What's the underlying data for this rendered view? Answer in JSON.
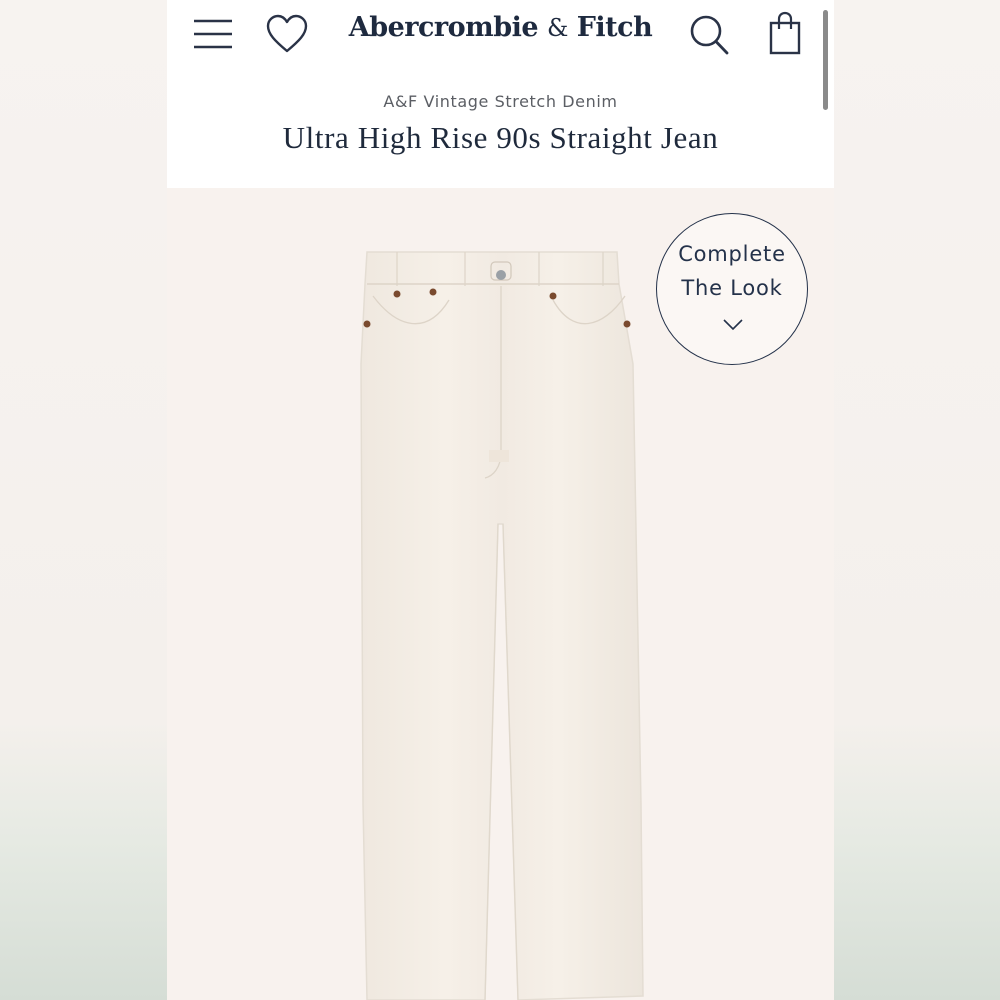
{
  "header": {
    "brand_name": "Abercrombie",
    "brand_amp": "&",
    "brand_name_2": "Fitch",
    "icons": [
      "menu-icon",
      "heart-icon",
      "search-icon",
      "shopping-bag-icon"
    ]
  },
  "product": {
    "collection": "A&F Vintage Stretch Denim",
    "title": "Ultra High Rise 90s Straight Jean"
  },
  "complete_the_look": {
    "line1": "Complete",
    "line2": "The Look",
    "icon": "chevron-down-icon"
  },
  "colors": {
    "brand_navy": "#1e2a3f",
    "image_background": "#f8f2ee",
    "jeans_color": "#f4eee6",
    "rivet_color": "#7a4a2e"
  }
}
